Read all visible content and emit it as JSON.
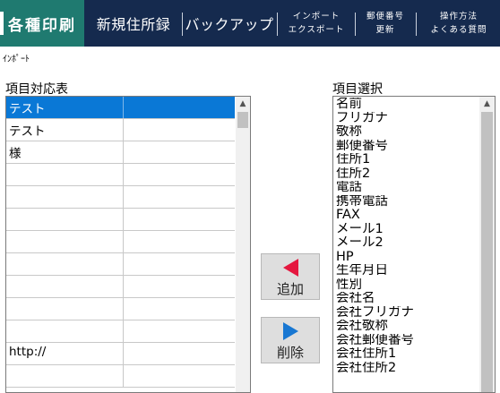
{
  "nav": {
    "print": "各種印刷",
    "new_address": "新規住所録",
    "backup": "バックアップ",
    "import_line1": "インポート",
    "import_line2": "エクスポート",
    "postal_line1": "郵便番号",
    "postal_line2": "更新",
    "help_line1": "操作方法",
    "help_line2": "よくある質問"
  },
  "page_subtitle": "ｲﾝﾎﾟｰﾄ",
  "mapping": {
    "label": "項目対応表",
    "rows": [
      {
        "field": "テスト",
        "value": "",
        "selected": true
      },
      {
        "field": "テスト",
        "value": ""
      },
      {
        "field": "様",
        "value": ""
      },
      {
        "field": "",
        "value": ""
      },
      {
        "field": "",
        "value": ""
      },
      {
        "field": "",
        "value": ""
      },
      {
        "field": "",
        "value": ""
      },
      {
        "field": "",
        "value": ""
      },
      {
        "field": "",
        "value": ""
      },
      {
        "field": "",
        "value": ""
      },
      {
        "field": "",
        "value": ""
      },
      {
        "field": "http://",
        "value": ""
      },
      {
        "field": "",
        "value": ""
      }
    ]
  },
  "buttons": {
    "add": "追加",
    "remove": "削除"
  },
  "field_select": {
    "label": "項目選択",
    "items": [
      "名前",
      "フリガナ",
      "敬称",
      "郵便番号",
      "住所1",
      "住所2",
      "電話",
      "携帯電話",
      "FAX",
      "メール1",
      "メール2",
      "HP",
      "生年月日",
      "性別",
      "会社名",
      "会社フリガナ",
      "会社敬称",
      "会社郵便番号",
      "会社住所1",
      "会社住所2"
    ]
  },
  "icons": {
    "scroll_up": "▲",
    "add_arrow": "left-arrow",
    "remove_arrow": "right-arrow"
  },
  "colors": {
    "nav_bg": "#152a4e",
    "nav_active": "#1f7a70",
    "selection": "#0a78d6",
    "add_icon": "#e5173f",
    "remove_icon": "#1877d2"
  }
}
